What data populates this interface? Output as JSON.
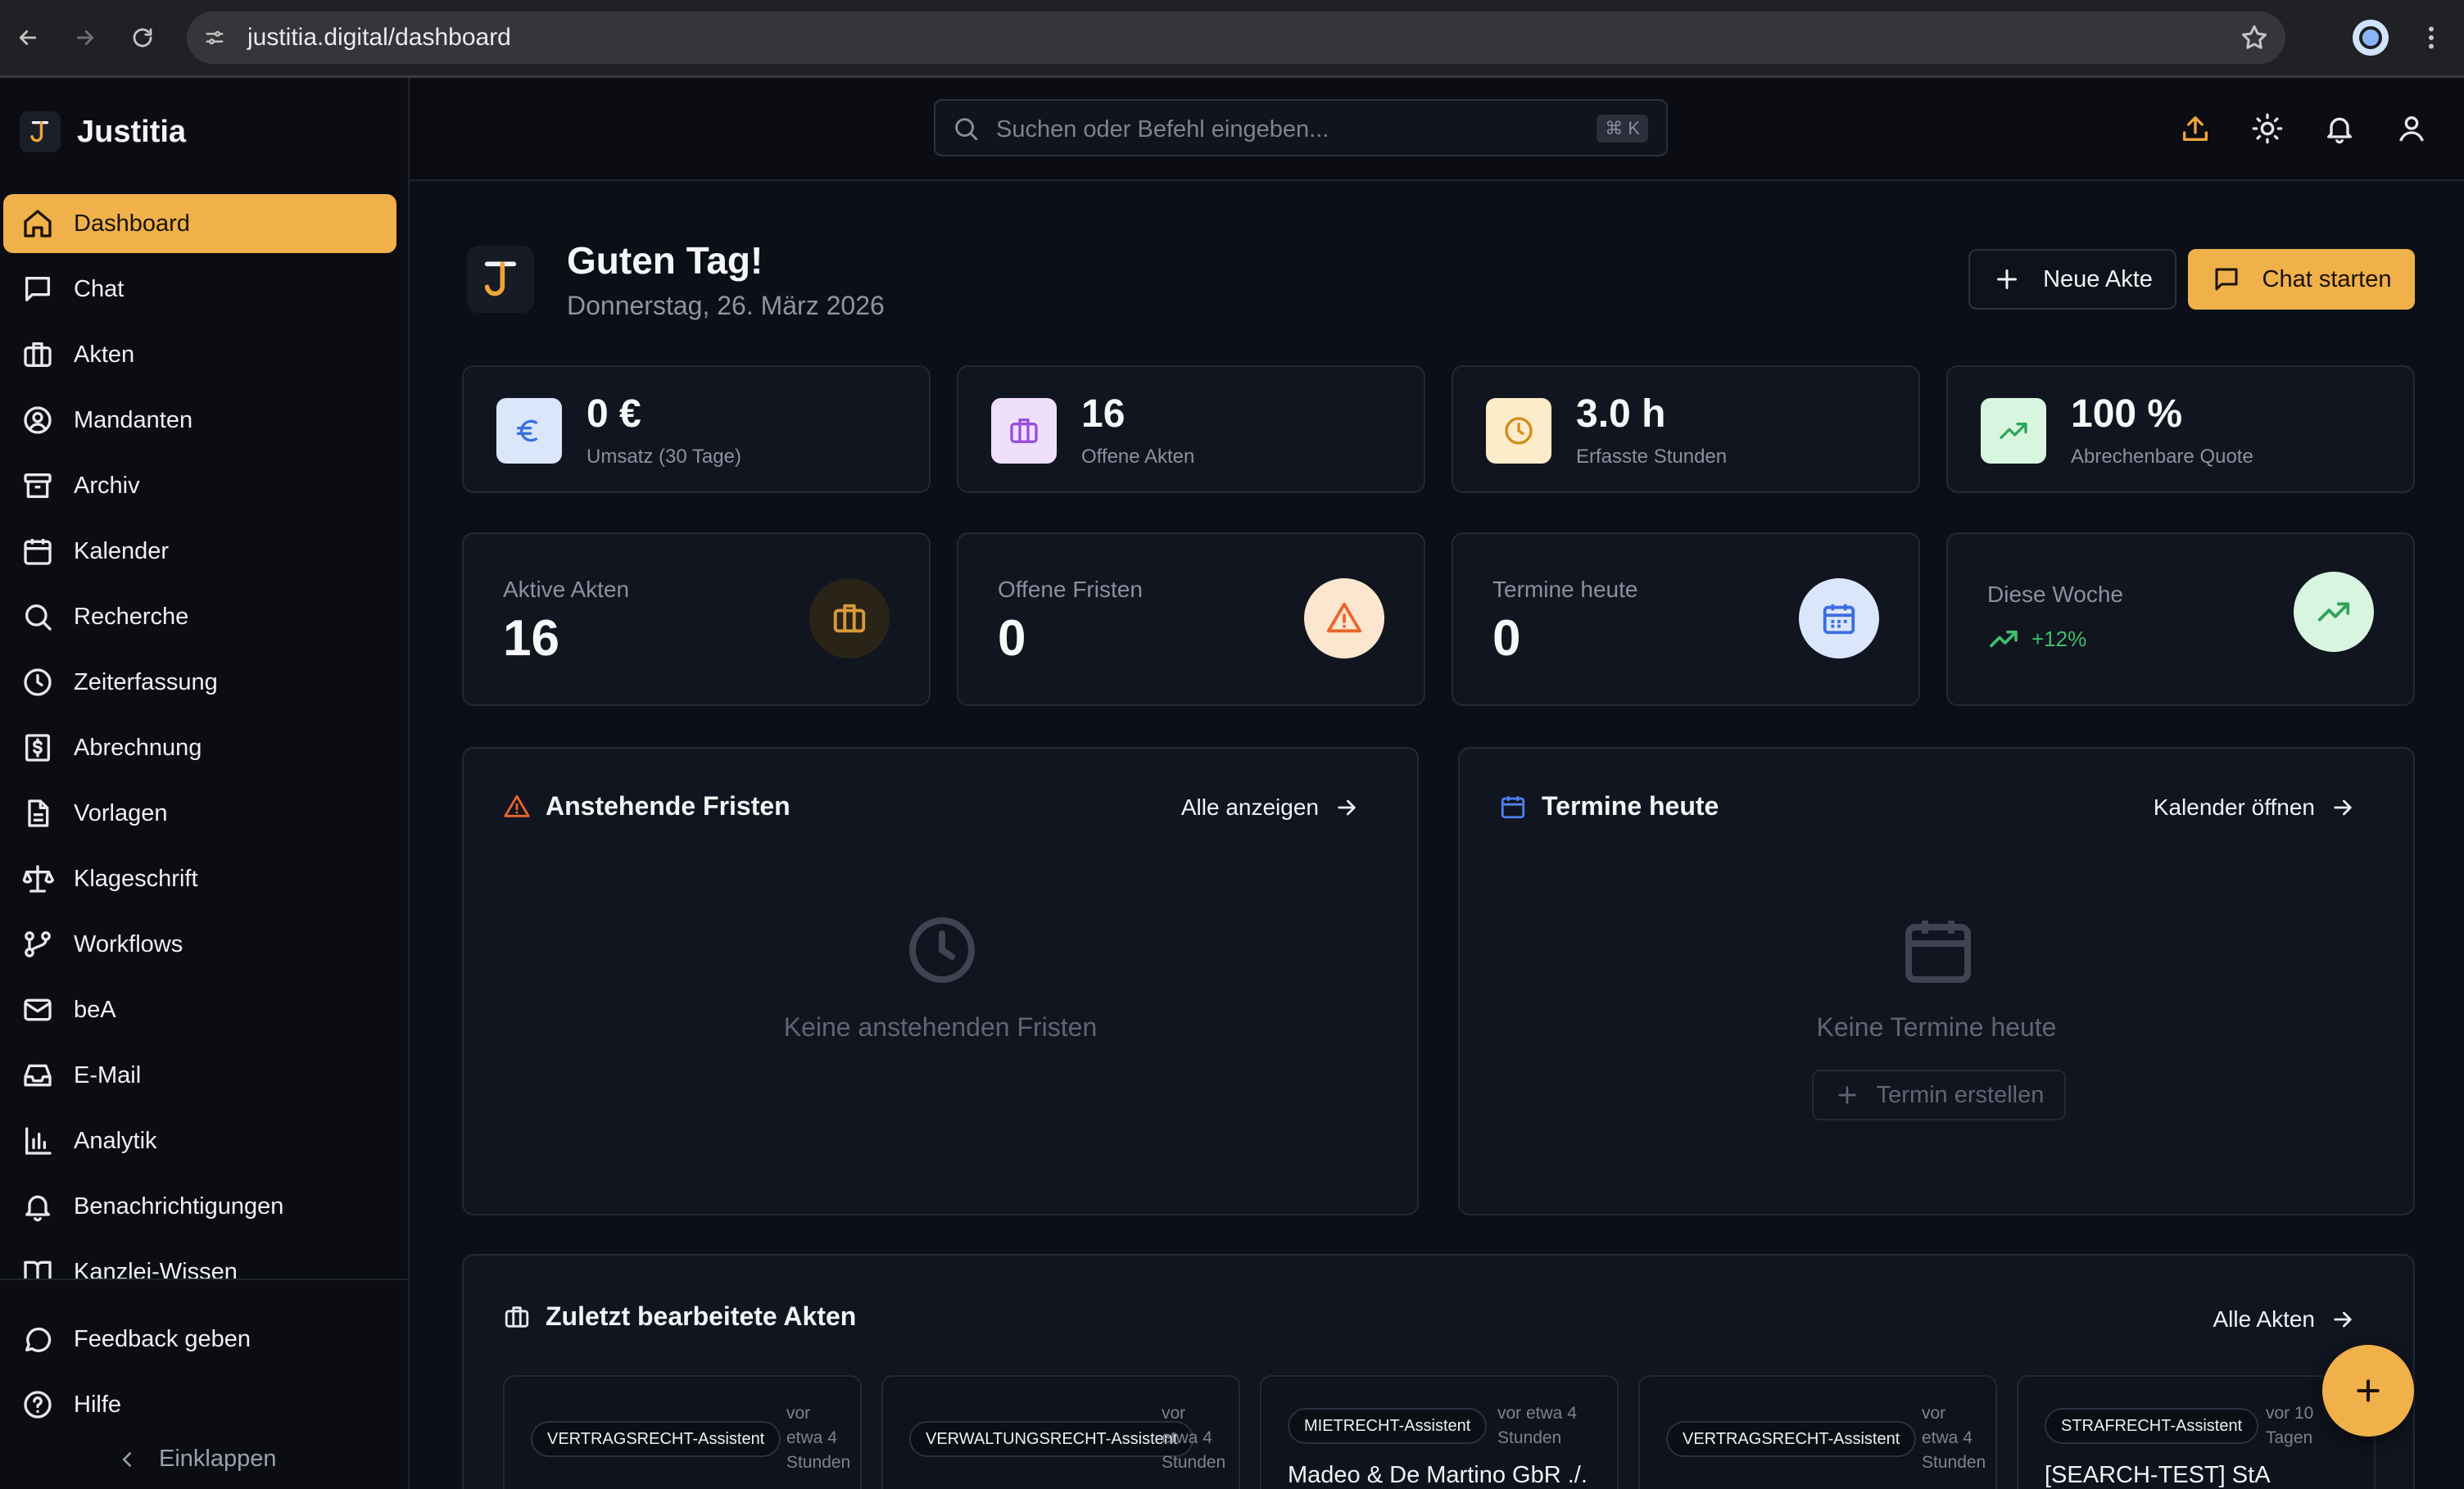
{
  "browser": {
    "url": "justitia.digital/dashboard"
  },
  "brand": {
    "name": "Justitia"
  },
  "sidebar": {
    "items": [
      {
        "label": "Dashboard",
        "icon": "home-icon",
        "active": true
      },
      {
        "label": "Chat",
        "icon": "message-square-icon"
      },
      {
        "label": "Akten",
        "icon": "briefcase-icon"
      },
      {
        "label": "Mandanten",
        "icon": "user-circle-icon"
      },
      {
        "label": "Archiv",
        "icon": "archive-icon"
      },
      {
        "label": "Kalender",
        "icon": "calendar-icon"
      },
      {
        "label": "Recherche",
        "icon": "search-icon"
      },
      {
        "label": "Zeiterfassung",
        "icon": "clock-icon"
      },
      {
        "label": "Abrechnung",
        "icon": "receipt-dollar-icon"
      },
      {
        "label": "Vorlagen",
        "icon": "file-text-icon"
      },
      {
        "label": "Klageschrift",
        "icon": "scale-icon"
      },
      {
        "label": "Workflows",
        "icon": "git-branch-icon"
      },
      {
        "label": "beA",
        "icon": "mail-icon"
      },
      {
        "label": "E-Mail",
        "icon": "inbox-icon"
      },
      {
        "label": "Analytik",
        "icon": "bar-chart-icon"
      },
      {
        "label": "Benachrichtigungen",
        "icon": "bell-icon"
      },
      {
        "label": "Kanzlei-Wissen",
        "icon": "book-open-icon"
      }
    ],
    "bottom": {
      "feedback": "Feedback geben",
      "help": "Hilfe",
      "collapse": "Einklappen"
    }
  },
  "topbar": {
    "search_placeholder": "Suchen oder Befehl eingeben...",
    "shortcut": "⌘ K"
  },
  "greeting": {
    "title": "Guten Tag!",
    "date": "Donnerstag, 26. März 2026"
  },
  "actions": {
    "new_case": "Neue Akte",
    "start_chat": "Chat starten"
  },
  "kpis": [
    {
      "value": "0 €",
      "label": "Umsatz (30 Tage)",
      "icon": "euro-icon",
      "color": "#3b6fe0",
      "bg": "#dbe6fb"
    },
    {
      "value": "16",
      "label": "Offene Akten",
      "icon": "briefcase-icon",
      "color": "#9b4de0",
      "bg": "#efdffb"
    },
    {
      "value": "3.0 h",
      "label": "Erfasste Stunden",
      "icon": "clock-icon",
      "color": "#d58a1c",
      "bg": "#fdecc9"
    },
    {
      "value": "100 %",
      "label": "Abrechenbare Quote",
      "icon": "trending-up-icon",
      "color": "#2fa45a",
      "bg": "#d8f5df"
    }
  ],
  "stats": [
    {
      "label": "Aktive Akten",
      "value": "16",
      "icon": "briefcase-icon",
      "color": "#d99a3a",
      "bg": "#2a2418"
    },
    {
      "label": "Offene Fristen",
      "value": "0",
      "icon": "alert-triangle-icon",
      "color": "#e8662a",
      "bg": "#fde6cf"
    },
    {
      "label": "Termine heute",
      "value": "0",
      "icon": "calendar-icon",
      "color": "#3b6fe0",
      "bg": "#dce6fb"
    },
    {
      "label": "Diese Woche",
      "trend": "+12%",
      "icon": "trending-up-icon",
      "color": "#2fa45a",
      "bg": "#d8f5df"
    }
  ],
  "deadlines": {
    "title": "Anstehende Fristen",
    "link": "Alle anzeigen",
    "empty": "Keine anstehenden Fristen"
  },
  "appointments": {
    "title": "Termine heute",
    "link": "Kalender öffnen",
    "empty": "Keine Termine heute",
    "create": "Termin erstellen"
  },
  "recent": {
    "title": "Zuletzt bearbeitete Akten",
    "link": "Alle Akten",
    "cards": [
      {
        "badge": "VERTRAGSRECHT-Assistent",
        "when": [
          "vor",
          "etwa 4",
          "Stunden"
        ],
        "name": ""
      },
      {
        "badge": "VERWALTUNGSRECHT-Assistent",
        "when": [
          "vor",
          "etwa 4",
          "Stunden"
        ],
        "name": ""
      },
      {
        "badge": "MIETRECHT-Assistent",
        "when": [
          "vor etwa 4",
          "Stunden"
        ],
        "name": "Madeo & De Martino GbR ./."
      },
      {
        "badge": "VERTRAGSRECHT-Assistent",
        "when": [
          "vor",
          "etwa 4",
          "Stunden"
        ],
        "name": ""
      },
      {
        "badge": "STRAFRECHT-Assistent",
        "when": [
          "vor 10",
          "Tagen"
        ],
        "name": "[SEARCH-TEST] StA"
      }
    ]
  }
}
